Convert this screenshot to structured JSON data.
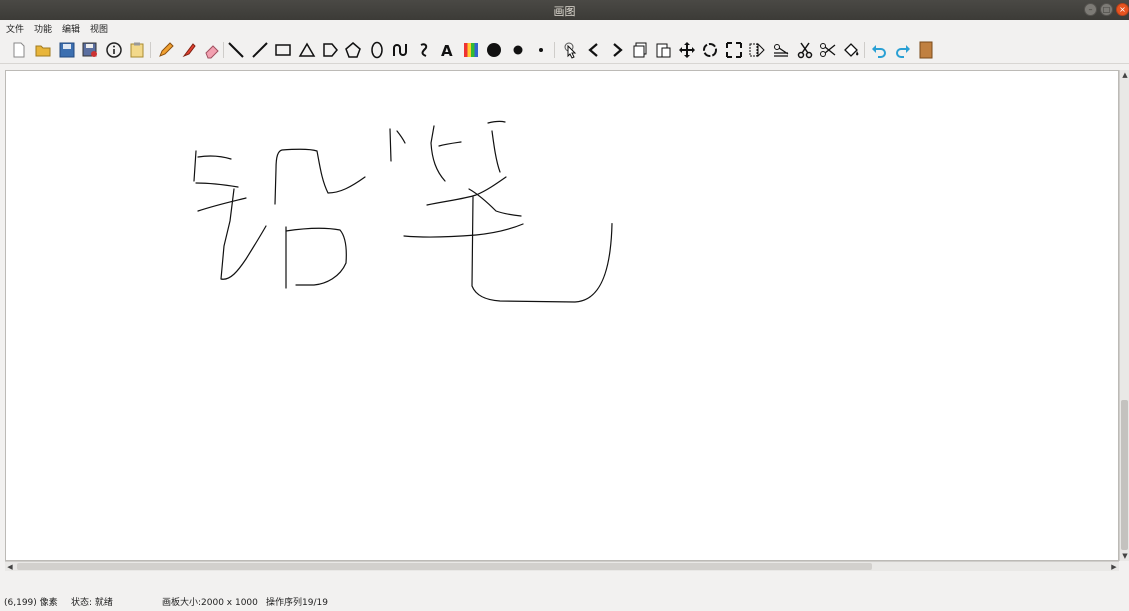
{
  "window": {
    "title": "画图"
  },
  "menu": [
    "文件",
    "功能",
    "编辑",
    "视图"
  ],
  "toolbar": {
    "tools": [
      {
        "name": "new-file-icon"
      },
      {
        "name": "open-folder-icon"
      },
      {
        "name": "save-icon"
      },
      {
        "name": "save-as-icon"
      },
      {
        "name": "info-icon"
      },
      {
        "name": "clipboard-icon"
      },
      {
        "name": "pencil-icon"
      },
      {
        "name": "brush-icon"
      },
      {
        "name": "eraser-icon"
      },
      {
        "name": "backslash-line-icon"
      },
      {
        "name": "line-icon"
      },
      {
        "name": "rectangle-icon"
      },
      {
        "name": "triangle-icon"
      },
      {
        "name": "pentagon-icon"
      },
      {
        "name": "polygon-icon"
      },
      {
        "name": "ellipse-icon"
      },
      {
        "name": "curve-icon"
      },
      {
        "name": "bezier-icon"
      },
      {
        "name": "text-icon"
      },
      {
        "name": "color-palette-icon"
      },
      {
        "name": "pen-large-icon"
      },
      {
        "name": "pen-medium-icon"
      },
      {
        "name": "pen-small-icon"
      },
      {
        "name": "pointer-icon"
      },
      {
        "name": "chevron-left-icon"
      },
      {
        "name": "chevron-right-icon"
      },
      {
        "name": "copy-icon"
      },
      {
        "name": "paste-icon"
      },
      {
        "name": "move-icon"
      },
      {
        "name": "rotate-icon"
      },
      {
        "name": "resize-icon"
      },
      {
        "name": "flip-icon"
      },
      {
        "name": "stamp-icon"
      },
      {
        "name": "cut-icon"
      },
      {
        "name": "scissors-icon"
      },
      {
        "name": "fill-bucket-icon"
      },
      {
        "name": "undo-icon"
      },
      {
        "name": "redo-icon"
      },
      {
        "name": "board-icon"
      }
    ]
  },
  "status": {
    "coords": "(6,199) 像素",
    "state": "状态: 就绪",
    "canvas_size": "画板大小:2000 x 1000",
    "sequence": "操作序列19/19"
  },
  "colors": {
    "title_bg": "#3c3b37",
    "undo_redo": "#2aa0d4",
    "close_button": "#e95420"
  }
}
